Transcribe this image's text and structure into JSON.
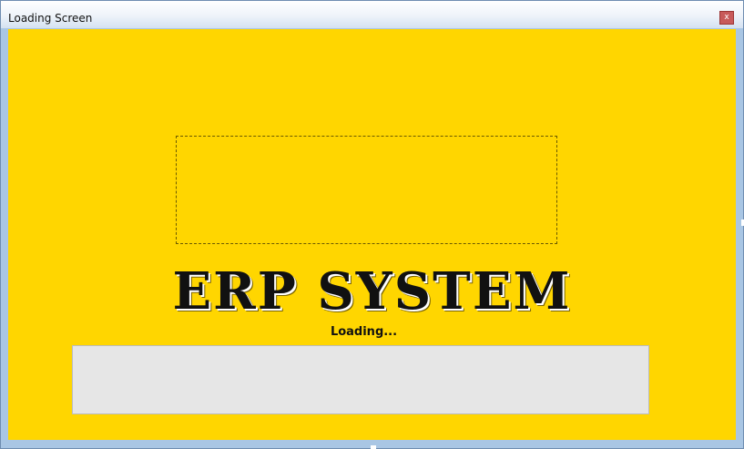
{
  "window": {
    "title": "Loading Screen",
    "close_glyph": "x"
  },
  "colors": {
    "background": "#ffd600",
    "title_text": "#111111",
    "progress_track": "#e6e6e6",
    "close_button": "#c85a5a"
  },
  "splash": {
    "app_title": "ERP SYSTEM",
    "loading_label": "Loading..."
  },
  "progress": {
    "value_fraction": 0
  },
  "icons": {
    "close": "close-icon"
  }
}
